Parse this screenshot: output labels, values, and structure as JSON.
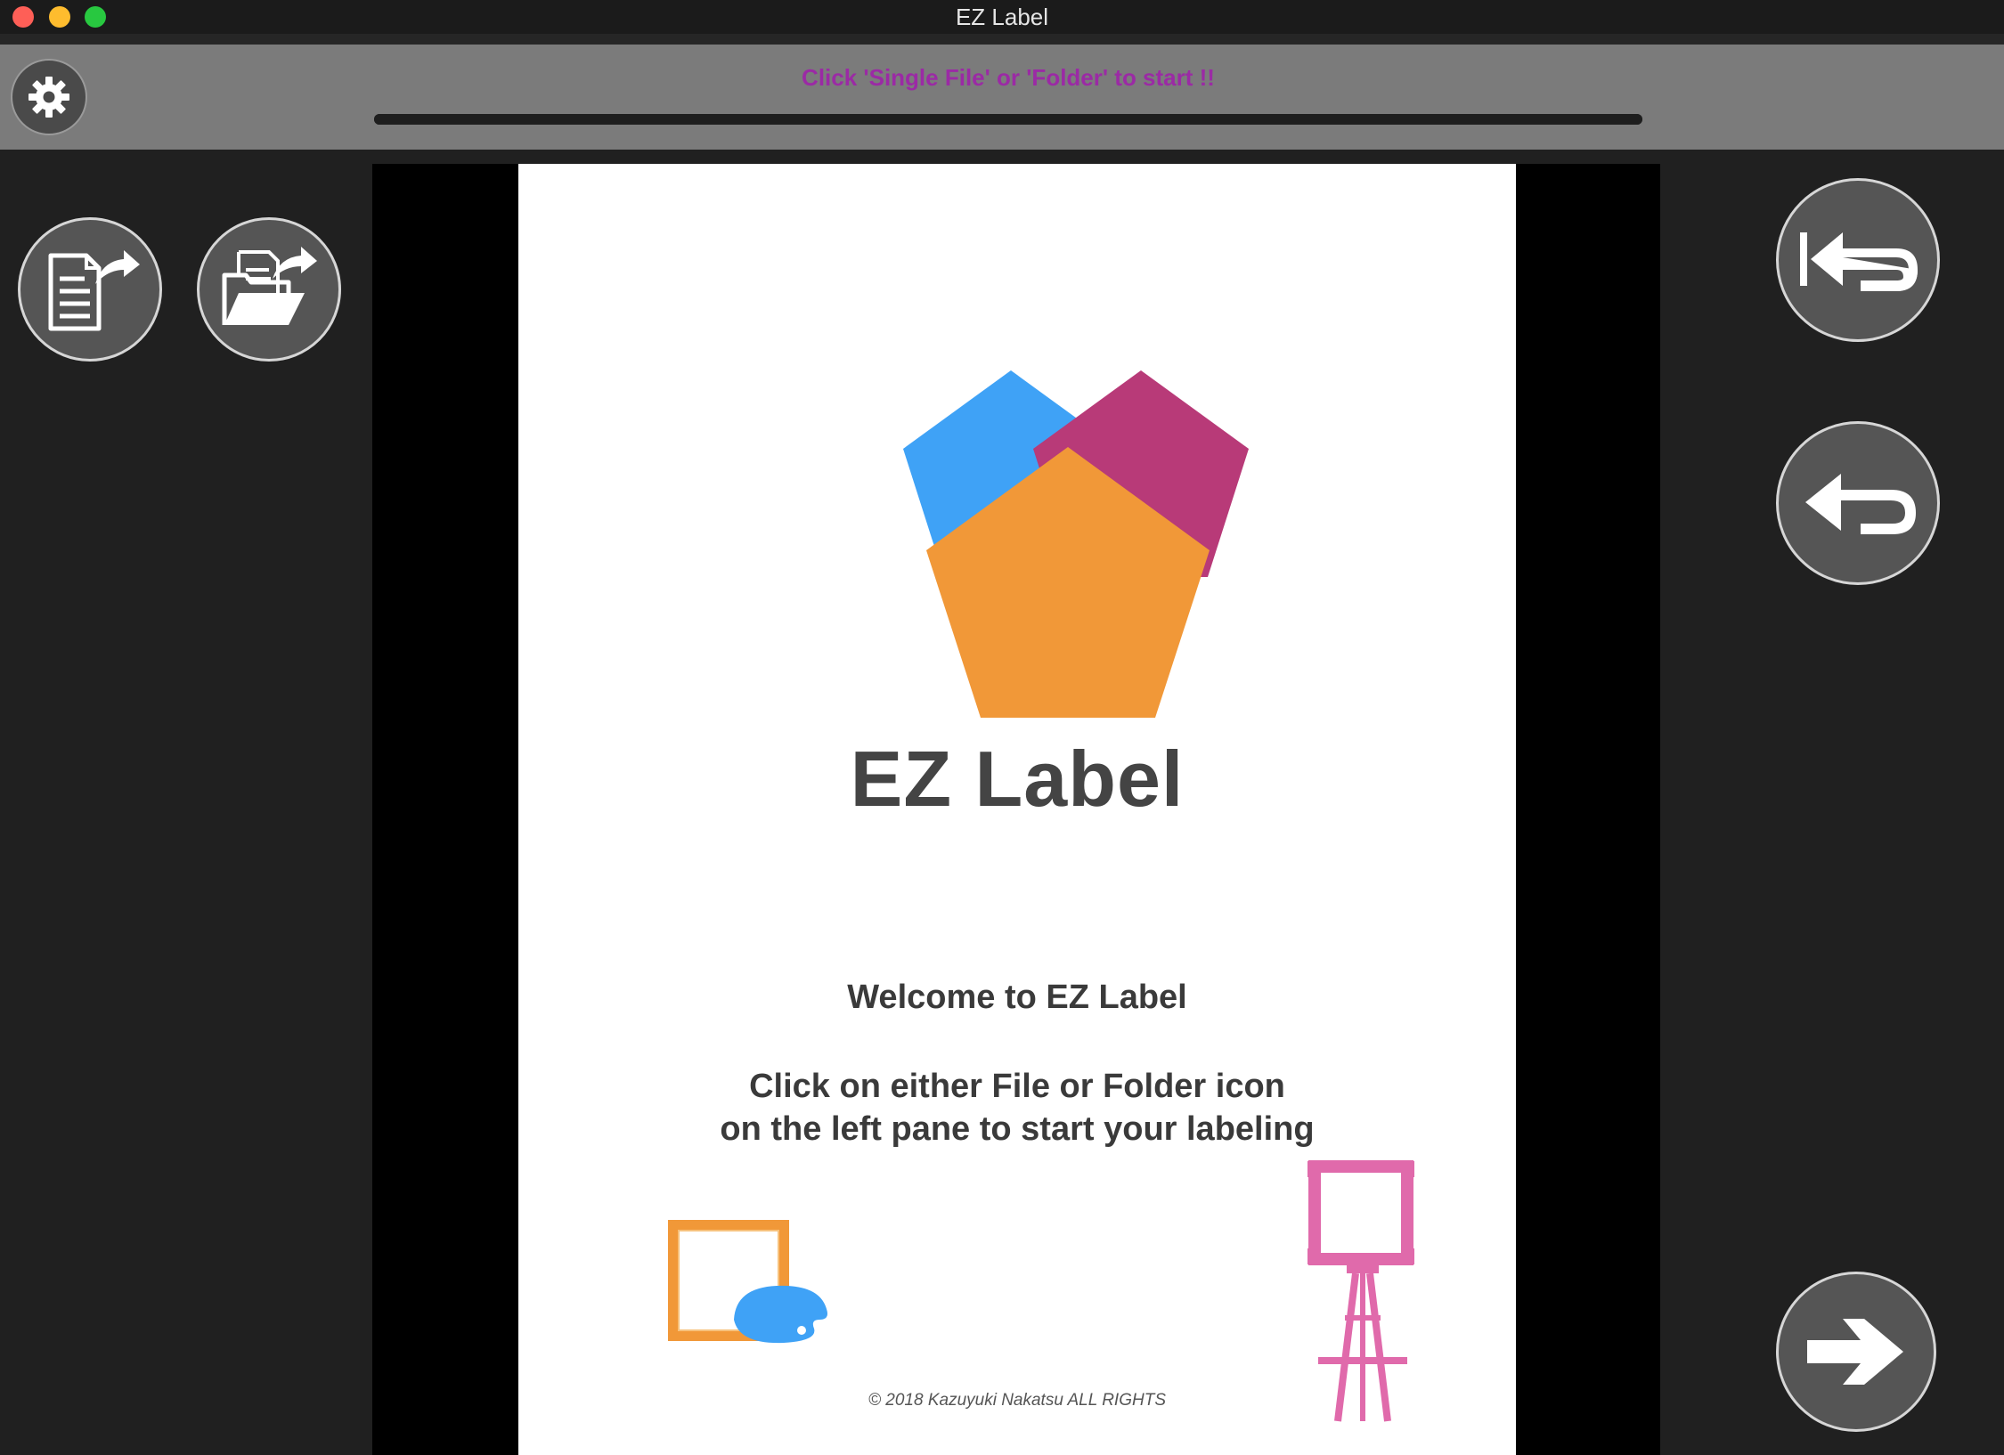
{
  "window": {
    "title": "EZ Label"
  },
  "toolbar": {
    "status_text": "Click 'Single File' or  'Folder' to start !!",
    "status_color": "#9b2aa5",
    "progress_percent": 100
  },
  "left_pane": {
    "buttons": [
      {
        "icon": "open-file-icon"
      },
      {
        "icon": "open-folder-icon"
      }
    ]
  },
  "right_pane": {
    "buttons": [
      {
        "icon": "back-to-first-icon"
      },
      {
        "icon": "back-icon"
      },
      {
        "icon": "next-arrow-icon"
      }
    ]
  },
  "splash": {
    "app_name": "EZ Label",
    "welcome": "Welcome to EZ Label",
    "instruction_line1": "Click on either File or Folder icon",
    "instruction_line2": "on the left pane to start your labeling",
    "copyright": "© 2018 Kazuyuki Nakatsu ALL RIGHTS",
    "logo_colors": {
      "blue": "#3fa2f6",
      "magenta": "#b83a78",
      "orange": "#f19838"
    }
  }
}
